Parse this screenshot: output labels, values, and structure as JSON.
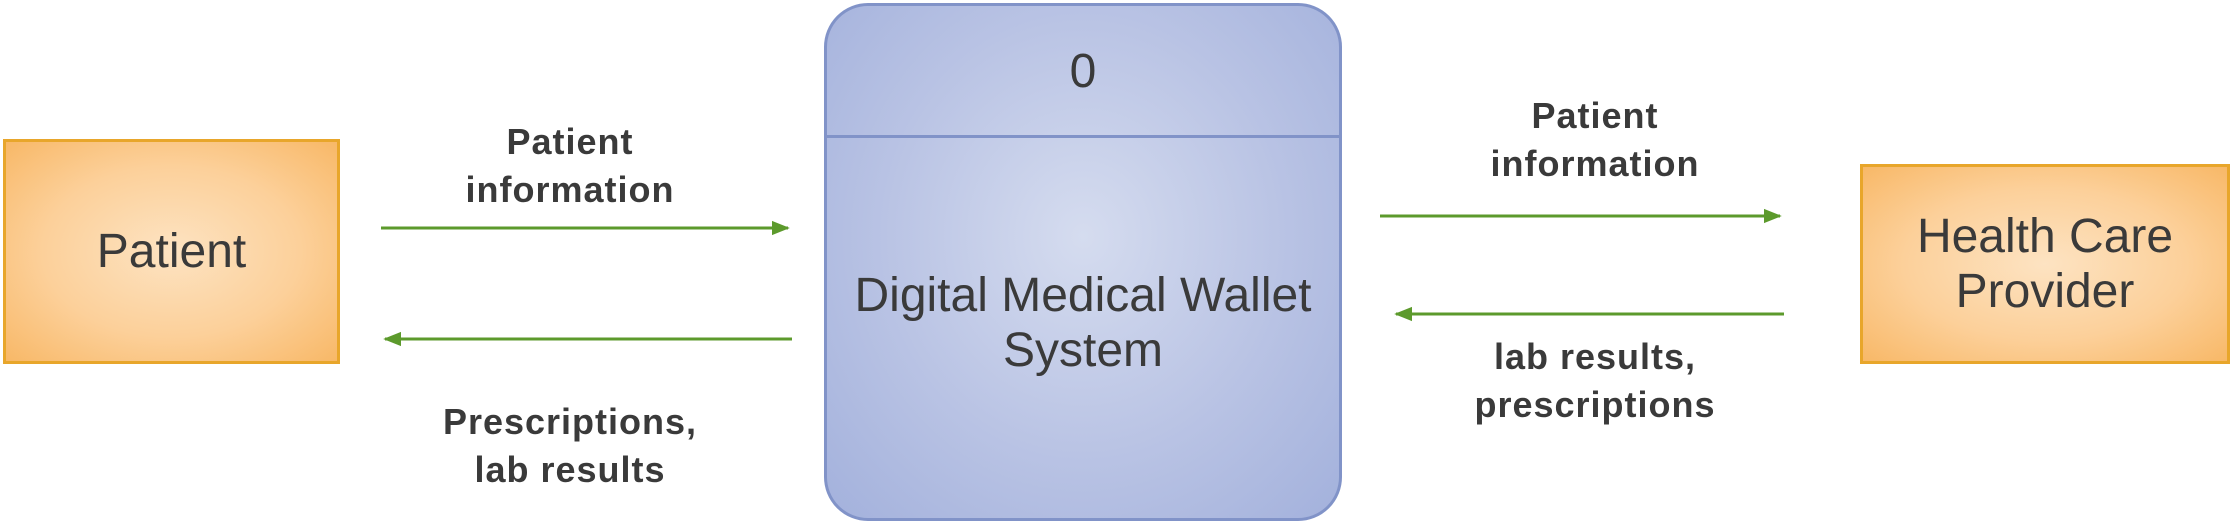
{
  "external_entities": {
    "patient": "Patient",
    "provider": "Health Care\nProvider"
  },
  "process": {
    "id": "0",
    "name": "Digital Medical Wallet\nSystem"
  },
  "flows": {
    "patient_to_system": "Patient\ninformation",
    "system_to_patient": "Prescriptions,\nlab results",
    "system_to_provider": "Patient\ninformation",
    "provider_to_system": "lab results,\nprescriptions"
  },
  "colors": {
    "entity_border": "#e8a62b",
    "entity_fill": "#fcd09a",
    "process_border": "#8193c8",
    "process_fill": "#b9c3e4",
    "arrow": "#5c9a2c",
    "text": "#3a3a3a"
  }
}
